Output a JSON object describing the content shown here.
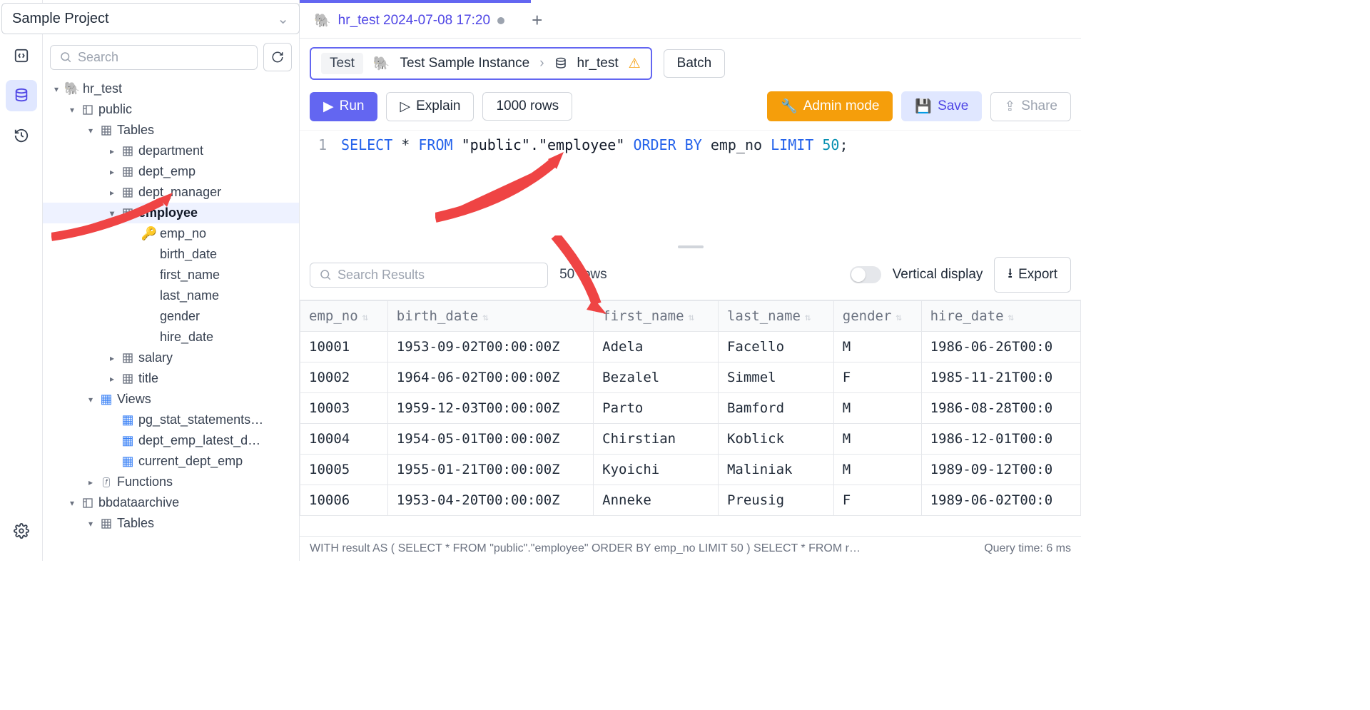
{
  "project": {
    "name": "Sample Project"
  },
  "sidebar": {
    "search_placeholder": "Search",
    "tree": {
      "db": "hr_test",
      "schema": "public",
      "tables_label": "Tables",
      "tables": [
        "department",
        "dept_emp",
        "dept_manager",
        "employee",
        "salary",
        "title"
      ],
      "employee_cols": [
        {
          "name": "emp_no",
          "key": true
        },
        {
          "name": "birth_date",
          "key": false
        },
        {
          "name": "first_name",
          "key": false
        },
        {
          "name": "last_name",
          "key": false
        },
        {
          "name": "gender",
          "key": false
        },
        {
          "name": "hire_date",
          "key": false
        }
      ],
      "views_label": "Views",
      "views": [
        "pg_stat_statements…",
        "dept_emp_latest_d…",
        "current_dept_emp"
      ],
      "functions_label": "Functions",
      "archive_db": "bbdataarchive",
      "archive_tables_label": "Tables"
    }
  },
  "tabs": {
    "active": "hr_test 2024-07-08 17:20"
  },
  "breadcrumb": {
    "env": "Test",
    "instance": "Test Sample Instance",
    "db": "hr_test"
  },
  "toolbar": {
    "batch": "Batch",
    "run": "Run",
    "explain": "Explain",
    "rowlimit": "1000 rows",
    "admin": "Admin mode",
    "save": "Save",
    "share": "Share"
  },
  "editor": {
    "line": "1",
    "sql_parts": {
      "select": "SELECT",
      "star": "*",
      "from": "FROM",
      "table": "\"public\".\"employee\"",
      "order": "ORDER BY",
      "col": "emp_no",
      "limit": "LIMIT",
      "n": "50",
      "semi": ";"
    }
  },
  "results_bar": {
    "search_placeholder": "Search Results",
    "rowcount": "50 rows",
    "vertical": "Vertical display",
    "export": "Export"
  },
  "results": {
    "columns": [
      "emp_no",
      "birth_date",
      "first_name",
      "last_name",
      "gender",
      "hire_date"
    ],
    "rows": [
      [
        "10001",
        "1953-09-02T00:00:00Z",
        "Adela",
        "Facello",
        "M",
        "1986-06-26T00:0"
      ],
      [
        "10002",
        "1964-06-02T00:00:00Z",
        "Bezalel",
        "Simmel",
        "F",
        "1985-11-21T00:0"
      ],
      [
        "10003",
        "1959-12-03T00:00:00Z",
        "Parto",
        "Bamford",
        "M",
        "1986-08-28T00:0"
      ],
      [
        "10004",
        "1954-05-01T00:00:00Z",
        "Chirstian",
        "Koblick",
        "M",
        "1986-12-01T00:0"
      ],
      [
        "10005",
        "1955-01-21T00:00:00Z",
        "Kyoichi",
        "Maliniak",
        "M",
        "1989-09-12T00:0"
      ],
      [
        "10006",
        "1953-04-20T00:00:00Z",
        "Anneke",
        "Preusig",
        "F",
        "1989-06-02T00:0"
      ]
    ]
  },
  "status": {
    "query": "WITH result AS ( SELECT * FROM \"public\".\"employee\" ORDER BY emp_no LIMIT 50 ) SELECT * FROM r…",
    "time": "Query time: 6 ms"
  }
}
